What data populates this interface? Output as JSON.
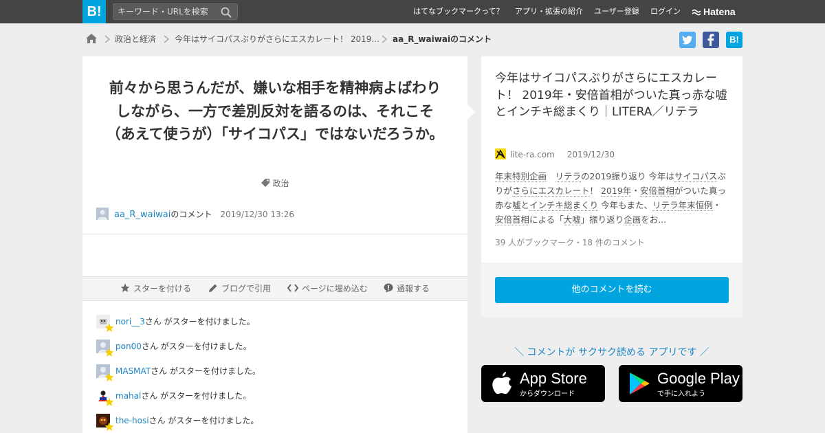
{
  "header": {
    "logo": "B!",
    "search_placeholder": "キーワード・URLを検索",
    "nav": [
      "はてなブックマークって？",
      "アプリ・拡張の紹介",
      "ユーザー登録",
      "ログイン"
    ],
    "brand": "Hatena"
  },
  "breadcrumb": {
    "items": [
      "政治と経済",
      "今年はサイコパスぶりがさらにエスカレート！ 2019...",
      "aa_R_waiwaiのコメント"
    ]
  },
  "share": {
    "twitter_icon": "twitter-icon",
    "facebook_icon": "facebook-icon",
    "hatena_label": "B!"
  },
  "comment": {
    "text": "前々から思うんだが、嫌いな相手を精神病よばわりしながら、一方で差別反対を語るのは、それこそ（あえて使うが）「サイコパス」ではないだろうか。",
    "tag": "政治",
    "user": "aa_R_waiwai",
    "user_suffix": "のコメント",
    "datetime": "2019/12/30 13:26"
  },
  "actions": {
    "star": "スターを付ける",
    "blog": "ブログで引用",
    "embed": "ページに埋め込む",
    "report": "通報する"
  },
  "stars": {
    "suffix": "さん がスターを付けました。",
    "users": [
      "nori__3",
      "pon00",
      "MASMAT",
      "mahal",
      "the-hosi"
    ]
  },
  "entry": {
    "title": "今年はサイコパスぶりがさらにエスカレート！ 2019年・安倍首相がついた真っ赤な嘘とインチキ総まくり｜LITERA／リテラ",
    "site": "lite-ra.com",
    "date": "2019/12/30",
    "summary": {
      "s1": "年末特別企画",
      "s2": "リテラ",
      "s3": "の2019振り返り 今年は",
      "s4": "サイコパス",
      "s5": "ぶりが",
      "s6": "さらに",
      "s7": "エスカレート",
      "s8": "！ ",
      "s9": "2019年",
      "s10": "・",
      "s11": "安倍首相",
      "s12": "がついた真っ赤な",
      "s13": "嘘",
      "s14": "と",
      "s15": "インチキ",
      "s16": "総まくり",
      "s17": " 今年もまた、",
      "s18": "リテラ",
      "s19": "年末",
      "s20": "恒例",
      "s21": "・",
      "s22": "安倍首相",
      "s23": "による「",
      "s24": "大嘘",
      "s25": "」振り返り",
      "s26": "企画",
      "s27": "をお..."
    },
    "counts": "39 人がブックマーク・18 件のコメント",
    "read_more": "他のコメントを読む"
  },
  "promo": {
    "text": "＼ コメントが サクサク読める アプリです ／",
    "appstore_big": "App Store",
    "appstore_small": "からダウンロード",
    "googleplay_big": "Google Play",
    "googleplay_small": "で手に入れよう"
  },
  "colors": {
    "accent": "#00a4de",
    "link": "#1f86c3",
    "topbar": "#444444",
    "twitter": "#55acee",
    "facebook": "#3b5998"
  }
}
